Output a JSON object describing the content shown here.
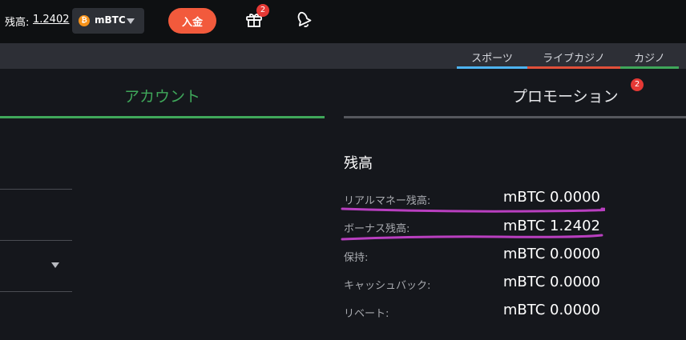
{
  "header": {
    "balance_label": "残高:",
    "balance_value": "1.2402",
    "currency_coin": "₿",
    "currency": "mBTC",
    "deposit_label": "入金",
    "gift_badge": "2"
  },
  "subnav": {
    "tabs": [
      {
        "label": "スポーツ",
        "color": "#4db3f0"
      },
      {
        "label": "ライブカジノ",
        "color": "#e2503a"
      },
      {
        "label": "カジノ",
        "color": "#3fa75a"
      }
    ]
  },
  "main_tabs": {
    "account": "アカウント",
    "promotion": "プロモーション",
    "promotion_badge": "2"
  },
  "balance_section": {
    "title": "残高",
    "rows": [
      {
        "label": "リアルマネー残高:",
        "value": "mBTC 0.0000"
      },
      {
        "label": "ボーナス残高:",
        "value": "mBTC 1.2402"
      },
      {
        "label": "保持:",
        "value": "mBTC 0.0000"
      },
      {
        "label": "キャッシュバック:",
        "value": "mBTC 0.0000"
      },
      {
        "label": "リベート:",
        "value": "mBTC 0.0000"
      }
    ]
  },
  "colors": {
    "accent_green": "#3fa75a",
    "deposit_red": "#f25a3c",
    "annotation_purple": "#b93fc0"
  }
}
